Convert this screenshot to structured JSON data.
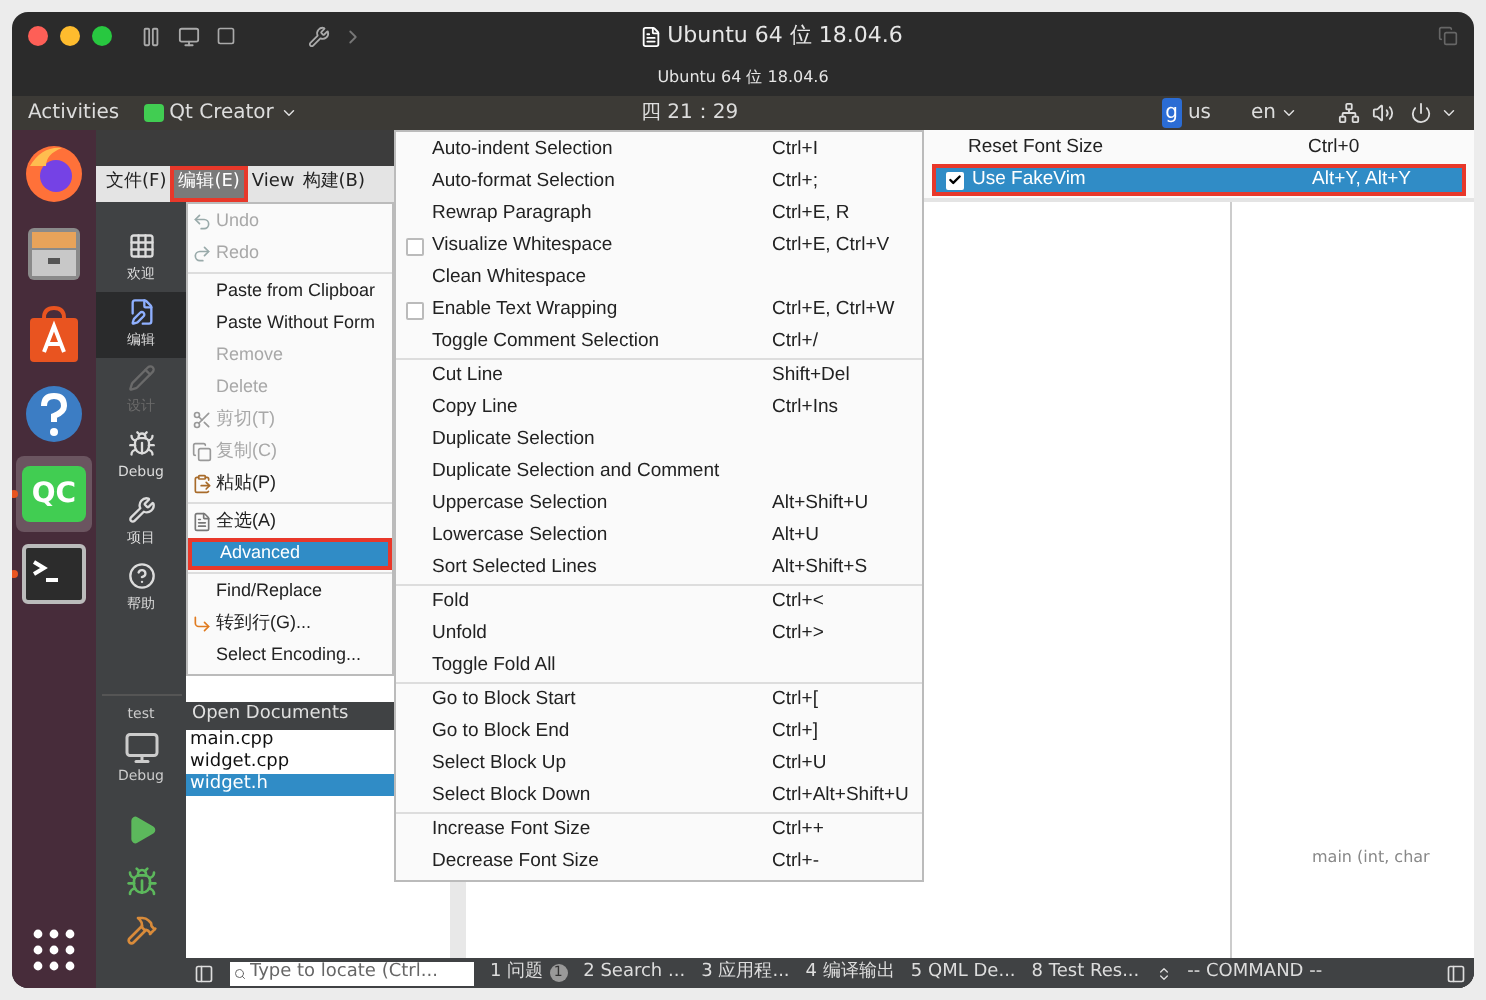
{
  "mac_window": {
    "title": "Ubuntu 64 位 18.04.6",
    "subtitle": "Ubuntu 64 位 18.04.6"
  },
  "top_bar": {
    "activities": "Activities",
    "app": "Qt Creator",
    "clock": "四 21：29",
    "input_badge": "g",
    "input": "us",
    "language": "en"
  },
  "dock": [
    {
      "kind": "browser",
      "running": false,
      "selected": false
    },
    {
      "kind": "files",
      "running": false,
      "selected": false
    },
    {
      "kind": "store",
      "running": false,
      "selected": false
    },
    {
      "kind": "help",
      "running": false,
      "selected": false
    },
    {
      "kind": "qt",
      "label": "QC",
      "running": true,
      "selected": true
    },
    {
      "kind": "terminal",
      "running": true,
      "selected": false
    }
  ],
  "menubar": [
    {
      "label": "文件(F)",
      "open": false,
      "highlighted": false
    },
    {
      "label": "编辑(E)",
      "open": true,
      "highlighted": true
    },
    {
      "label": "View",
      "open": false,
      "highlighted": false
    },
    {
      "label": "构建(B)",
      "open": false,
      "highlighted": false
    }
  ],
  "modes": [
    {
      "kind": "welcome",
      "label": "欢迎",
      "selected": false,
      "disabled": false
    },
    {
      "kind": "edit",
      "label": "编辑",
      "selected": true,
      "disabled": false
    },
    {
      "kind": "design",
      "label": "设计",
      "selected": false,
      "disabled": true
    },
    {
      "kind": "debug",
      "label": "Debug",
      "selected": false,
      "disabled": false
    },
    {
      "kind": "projects",
      "label": "项目",
      "selected": false,
      "disabled": false
    },
    {
      "kind": "help",
      "label": "帮助",
      "selected": false,
      "disabled": false
    }
  ],
  "kit": {
    "project": "test",
    "config": "Debug"
  },
  "edit_menu": [
    {
      "kind": "item",
      "label": "Undo",
      "disabled": true,
      "selected": false,
      "highlighted": false
    },
    {
      "kind": "item",
      "label": "Redo",
      "disabled": true,
      "selected": false,
      "highlighted": false
    },
    {
      "kind": "separator"
    },
    {
      "kind": "item",
      "label": "Paste from Clipboar",
      "disabled": false,
      "selected": false,
      "highlighted": false
    },
    {
      "kind": "item",
      "label": "Paste Without Form",
      "disabled": false,
      "selected": false,
      "highlighted": false
    },
    {
      "kind": "item",
      "label": "Remove",
      "disabled": true,
      "selected": false,
      "highlighted": false
    },
    {
      "kind": "item",
      "label": "Delete",
      "disabled": true,
      "selected": false,
      "highlighted": false
    },
    {
      "kind": "item",
      "label": "剪切(T)",
      "disabled": true,
      "selected": false,
      "highlighted": false
    },
    {
      "kind": "item",
      "label": "复制(C)",
      "disabled": true,
      "selected": false,
      "highlighted": false
    },
    {
      "kind": "item",
      "label": "粘贴(P)",
      "disabled": false,
      "selected": false,
      "highlighted": false
    },
    {
      "kind": "separator"
    },
    {
      "kind": "item",
      "label": "全选(A)",
      "disabled": false,
      "selected": false,
      "highlighted": false
    },
    {
      "kind": "item",
      "label": "Advanced",
      "disabled": false,
      "selected": true,
      "highlighted": true
    },
    {
      "kind": "separator"
    },
    {
      "kind": "item",
      "label": "Find/Replace",
      "disabled": false,
      "selected": false,
      "highlighted": false
    },
    {
      "kind": "item",
      "label": "转到行(G)...",
      "disabled": false,
      "selected": false,
      "highlighted": false
    },
    {
      "kind": "item",
      "label": "Select Encoding...",
      "disabled": false,
      "selected": false,
      "highlighted": false
    }
  ],
  "advanced_menu": [
    {
      "kind": "item",
      "label": "Auto-indent Selection",
      "shortcut": "Ctrl+I"
    },
    {
      "kind": "item",
      "label": "Auto-format Selection",
      "shortcut": "Ctrl+;"
    },
    {
      "kind": "item",
      "label": "Rewrap Paragraph",
      "shortcut": "Ctrl+E, R"
    },
    {
      "kind": "check",
      "label": "Visualize Whitespace",
      "shortcut": "Ctrl+E, Ctrl+V",
      "checked": false
    },
    {
      "kind": "item",
      "label": "Clean Whitespace"
    },
    {
      "kind": "check",
      "label": "Enable Text Wrapping",
      "shortcut": "Ctrl+E, Ctrl+W",
      "checked": false
    },
    {
      "kind": "item",
      "label": "Toggle Comment Selection",
      "shortcut": "Ctrl+/"
    },
    {
      "kind": "separator"
    },
    {
      "kind": "item",
      "label": "Cut Line",
      "shortcut": "Shift+Del"
    },
    {
      "kind": "item",
      "label": "Copy Line",
      "shortcut": "Ctrl+Ins"
    },
    {
      "kind": "item",
      "label": "Duplicate Selection"
    },
    {
      "kind": "item",
      "label": "Duplicate Selection and Comment"
    },
    {
      "kind": "item",
      "label": "Uppercase Selection",
      "shortcut": "Alt+Shift+U"
    },
    {
      "kind": "item",
      "label": "Lowercase Selection",
      "shortcut": "Alt+U"
    },
    {
      "kind": "item",
      "label": "Sort Selected Lines",
      "shortcut": "Alt+Shift+S"
    },
    {
      "kind": "separator"
    },
    {
      "kind": "item",
      "label": "Fold",
      "shortcut": "Ctrl+<"
    },
    {
      "kind": "item",
      "label": "Unfold",
      "shortcut": "Ctrl+>"
    },
    {
      "kind": "item",
      "label": "Toggle Fold All"
    },
    {
      "kind": "separator"
    },
    {
      "kind": "item",
      "label": "Go to Block Start",
      "shortcut": "Ctrl+["
    },
    {
      "kind": "item",
      "label": "Go to Block End",
      "shortcut": "Ctrl+]"
    },
    {
      "kind": "item",
      "label": "Select Block Up",
      "shortcut": "Ctrl+U"
    },
    {
      "kind": "item",
      "label": "Select Block Down",
      "shortcut": "Ctrl+Alt+Shift+U"
    },
    {
      "kind": "separator"
    },
    {
      "kind": "item",
      "label": "Increase Font Size",
      "shortcut": "Ctrl++"
    },
    {
      "kind": "item",
      "label": "Decrease Font Size",
      "shortcut": "Ctrl+-"
    }
  ],
  "font_menu": [
    {
      "kind": "item",
      "label": "Reset Font Size",
      "shortcut": "Ctrl+0",
      "selected": false,
      "highlighted": false
    },
    {
      "kind": "check",
      "label": "Use FakeVim",
      "shortcut": "Alt+Y, Alt+Y",
      "checked": true,
      "selected": true,
      "highlighted": true
    }
  ],
  "open_documents": {
    "title": "Open Documents",
    "files": [
      {
        "name": "main.cpp",
        "selected": false
      },
      {
        "name": "widget.cpp",
        "selected": false
      },
      {
        "name": "widget.h",
        "selected": true
      }
    ]
  },
  "outline": {
    "item": "main (int, char"
  },
  "status_bar": {
    "locate_placeholder": "Type to locate (Ctrl...",
    "panes": [
      {
        "number": "1",
        "label": "问题",
        "badge": "1"
      },
      {
        "number": "2",
        "label": "Search ..."
      },
      {
        "number": "3",
        "label": "应用程..."
      },
      {
        "number": "4",
        "label": "编译输出"
      },
      {
        "number": "5",
        "label": "QML De..."
      },
      {
        "number": "8",
        "label": "Test Res..."
      }
    ],
    "mode": "-- COMMAND --"
  }
}
